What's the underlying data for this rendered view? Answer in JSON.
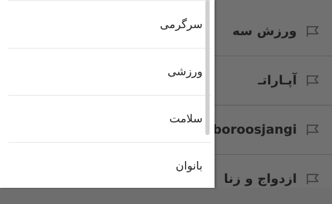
{
  "drawer": {
    "items": [
      {
        "label": "سرگرمی"
      },
      {
        "label": "ورزشی"
      },
      {
        "label": "سلامت"
      },
      {
        "label": "بانوان"
      }
    ]
  },
  "background_list": {
    "items": [
      {
        "label": "ورزش سه",
        "icon": "flag-icon"
      },
      {
        "label": "آپـاراتـ",
        "icon": "flag-icon"
      },
      {
        "label": "boroosjangi",
        "icon": "flag-icon"
      },
      {
        "label": "ازدواج و زنا",
        "icon": "flag-icon"
      }
    ]
  },
  "colors": {
    "overlay_dim": "#717171",
    "drawer_bg": "#ffffff",
    "text": "#222222",
    "scrollbar": "#cfcfcf"
  }
}
